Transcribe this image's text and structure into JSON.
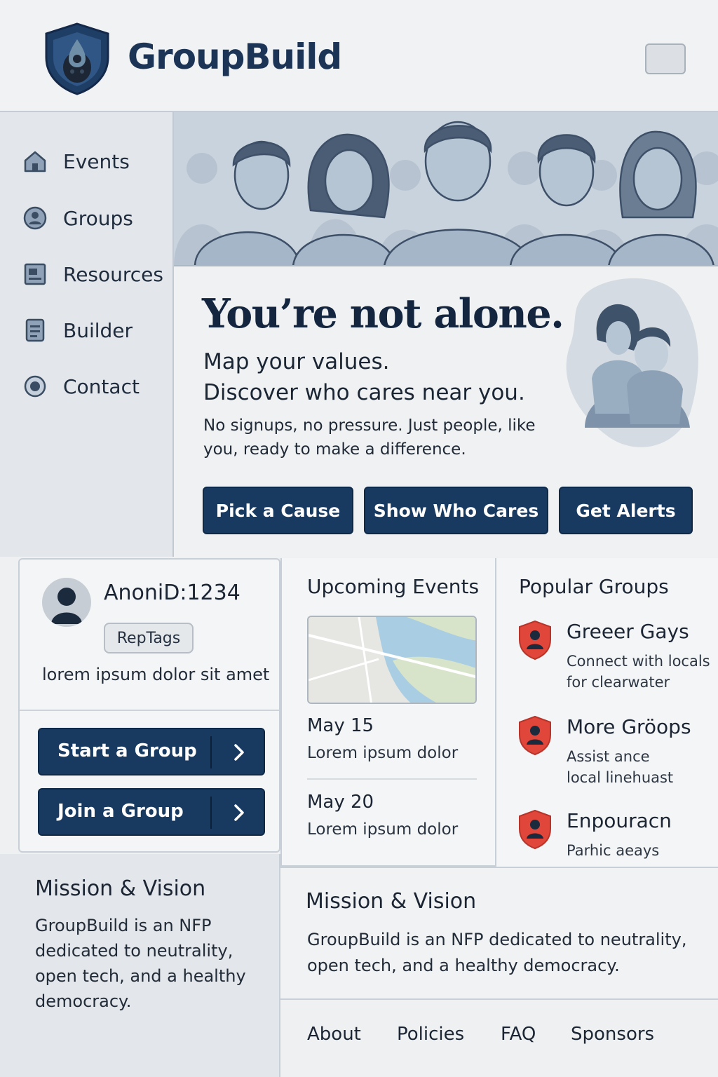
{
  "header": {
    "brand": "GroupBuild",
    "logo_icon": "shield-logo-icon",
    "menu_icon": "menu-icon"
  },
  "sidebar": {
    "items": [
      {
        "label": "Events",
        "icon": "home-icon"
      },
      {
        "label": "Groups",
        "icon": "user-circle-icon"
      },
      {
        "label": "Resources",
        "icon": "document-icon"
      },
      {
        "label": "Builder",
        "icon": "clipboard-icon"
      },
      {
        "label": "Contact",
        "icon": "target-icon"
      }
    ]
  },
  "hero": {
    "title": "You’re not alone.",
    "subtitle_line1": "Map your values.",
    "subtitle_line2": "Discover who cares near you.",
    "note": "No signups, no pressure. Just people, like you, ready to make a difference.",
    "buttons": [
      "Pick a Cause",
      "Show Who Cares",
      "Get Alerts"
    ]
  },
  "profile": {
    "name": "AnoniD:1234",
    "tag": "RepTags",
    "bio": "lorem ipsum dolor sit amet",
    "start_group": "Start a Group",
    "join_group": "Join a Group"
  },
  "events": {
    "title": "Upcoming Events",
    "items": [
      {
        "date": "May 15",
        "desc": "Lorem ipsum dolor"
      },
      {
        "date": "May 20",
        "desc": "Lorem ipsum dolor"
      }
    ]
  },
  "groups": {
    "title": "Popular Groups",
    "items": [
      {
        "name": "Greeer Gays",
        "desc": "Connect with locals for clearwater"
      },
      {
        "name": "More Gröops",
        "desc": "Assist ance local linehuast"
      },
      {
        "name": "Enpouracn",
        "desc": "Parhic aeays"
      }
    ]
  },
  "mission_left": {
    "title": "Mission & Vision",
    "text": "GroupBuild is an NFP dedicated to neutrality, open tech, and a healthy democracy."
  },
  "mission_right": {
    "title": "Mission & Vision",
    "text": "GroupBuild is an NFP dedicated to neutrality, open tech, and a healthy democracy."
  },
  "footer": {
    "links": [
      "About",
      "Policies",
      "FAQ",
      "Sponsors"
    ]
  },
  "colors": {
    "primary": "#183a60",
    "accent": "#e0463a",
    "background": "#eef0f2"
  }
}
